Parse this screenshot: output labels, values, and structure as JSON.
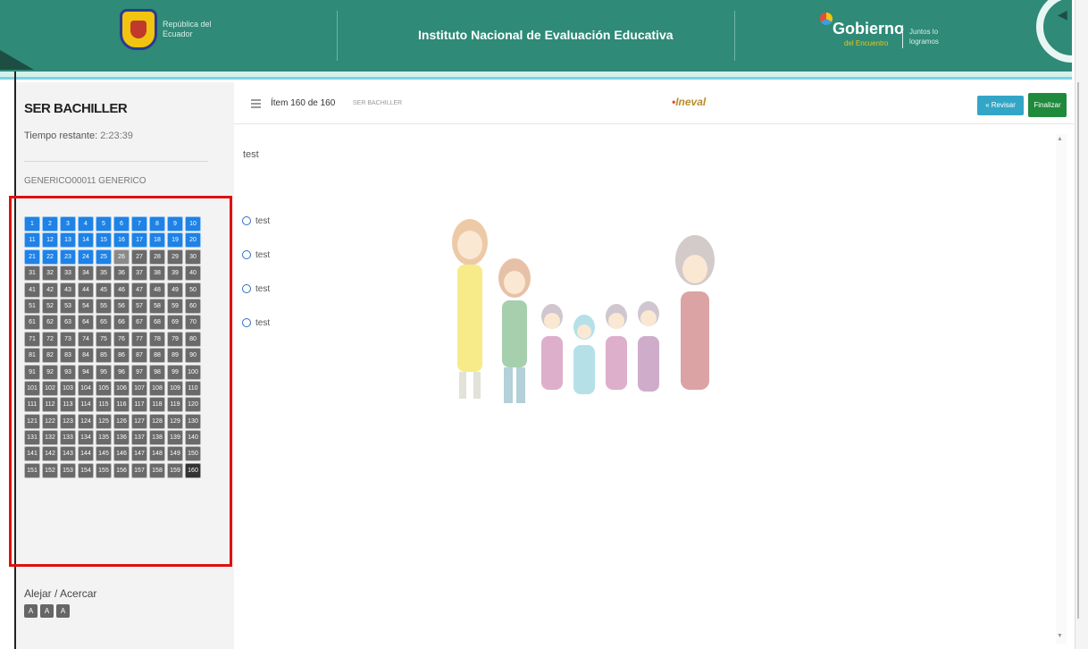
{
  "header": {
    "republic_text": "República del Ecuador",
    "institute_title": "Instituto Nacional de Evaluación Educativa",
    "gobierno_title": "Gobierno",
    "gobierno_sub": "del Encuentro",
    "gobierno_right": "Juntos lo logramos",
    "colors": {
      "header_bg": "#2f8a77",
      "accent_stripe": "#7dd3e6"
    }
  },
  "sidebar": {
    "exam_title": "SER BACHILLER",
    "time_label": "Tiempo restante:",
    "time_value": "2:23:39",
    "section_label": "GENERICO00011 GENERICO",
    "zoom_label": "Alejar / Acercar",
    "zoom_buttons": [
      "A",
      "A",
      "A"
    ]
  },
  "question_nav": {
    "total": 160,
    "answered_color": "#1e82e6",
    "pending_color": "#6a6a6a",
    "current_item": 160,
    "rows": [
      [
        1,
        2,
        3,
        4,
        5,
        6,
        7,
        8,
        9,
        10
      ],
      [
        11,
        12,
        13,
        14,
        15,
        16,
        17,
        18,
        19,
        20
      ],
      [
        21,
        22,
        23,
        24,
        25,
        26,
        27,
        28,
        29,
        30
      ],
      [
        31,
        32,
        33,
        34,
        35,
        36,
        37,
        38,
        39,
        40
      ],
      [
        41,
        42,
        43,
        44,
        45,
        46,
        47,
        48,
        49,
        50
      ],
      [
        51,
        52,
        53,
        54,
        55,
        56,
        57,
        58,
        59,
        60
      ],
      [
        61,
        62,
        63,
        64,
        65,
        66,
        67,
        68,
        69,
        70
      ],
      [
        71,
        72,
        73,
        74,
        75,
        76,
        77,
        78,
        79,
        80
      ],
      [
        81,
        82,
        83,
        84,
        85,
        86,
        87,
        88,
        89,
        90
      ],
      [
        91,
        92,
        93,
        94,
        95,
        96,
        97,
        98,
        99,
        100
      ],
      [
        101,
        102,
        103,
        104,
        105,
        106,
        107,
        108,
        109,
        110
      ],
      [
        111,
        112,
        113,
        114,
        115,
        116,
        117,
        118,
        119,
        120
      ],
      [
        121,
        122,
        123,
        124,
        125,
        126,
        127,
        128,
        129,
        130
      ],
      [
        131,
        132,
        133,
        134,
        135,
        136,
        137,
        138,
        139,
        140
      ],
      [
        141,
        142,
        143,
        144,
        145,
        146,
        147,
        148,
        149,
        150
      ],
      [
        151,
        152,
        153,
        154,
        155,
        156,
        157,
        158,
        159,
        160
      ]
    ],
    "answered_count": 25
  },
  "topbar": {
    "menu_icon": "hamburger-icon",
    "item_counter": "Ítem 160 de 160",
    "item_section": "SER BACHILLER",
    "center_logo": "Ineval",
    "revisar_label": "« Revisar",
    "finalizar_label": "Finalizar"
  },
  "question": {
    "prompt": "test",
    "options": [
      "test",
      "test",
      "test",
      "test"
    ]
  }
}
